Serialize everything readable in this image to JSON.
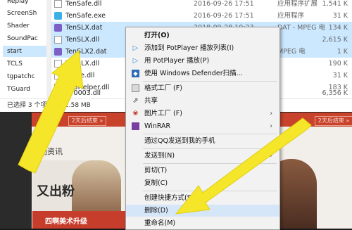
{
  "nav": {
    "items": [
      {
        "label": "Replay"
      },
      {
        "label": "ScreenSh"
      },
      {
        "label": "Shader"
      },
      {
        "label": "SoundPac"
      },
      {
        "label": "start"
      },
      {
        "label": "TCLS"
      },
      {
        "label": "tgpatchc"
      },
      {
        "label": "TGuard"
      }
    ]
  },
  "files": [
    {
      "name": "TenSafe.dll",
      "date": "2016-09-26 17:51",
      "type": "应用程序扩展",
      "size": "1,541 K",
      "icon": "dll-icon",
      "selected": false
    },
    {
      "name": "TenSafe.exe",
      "date": "2016-09-26 17:51",
      "type": "应用程序",
      "size": "31 K",
      "icon": "exe-icon",
      "selected": false
    },
    {
      "name": "TenSLX.dat",
      "date": "2018-09-28 10:23",
      "type": "DAT - MPEG 电",
      "size": "134 K",
      "icon": "dat-icon",
      "selected": true
    },
    {
      "name": "TenSLX.dll",
      "date": "",
      "type": "",
      "size": "2,615 K",
      "icon": "dll-icon",
      "selected": true
    },
    {
      "name": "TenSLX2.dat",
      "date": "",
      "type": "MPEG 电",
      "size": "1 K",
      "icon": "dat-icon",
      "selected": true
    },
    {
      "name": "TenSLX.dll",
      "date": "",
      "type": "",
      "size": "190 K",
      "icon": "dll-icon",
      "selected": false
    },
    {
      "name": "Tence.dll",
      "date": "",
      "type": "",
      "size": "31 K",
      "icon": "dll-icon",
      "selected": false
    },
    {
      "name": "TP3Helper.dll",
      "date": "",
      "type": "",
      "size": "183 K",
      "icon": "dll-icon",
      "selected": false
    },
    {
      "name": "TP0003.dll",
      "date": "",
      "type": "",
      "size": "6,356 K",
      "icon": "dll-icon",
      "selected": false
    }
  ],
  "status": {
    "selected": "已选择 3 个项目",
    "size": "2.58 MB"
  },
  "background": {
    "tag_left": "2天后结束 »",
    "tag_right": "2天后结束 »",
    "section_title": "热门资讯",
    "promo_title": "又出粉",
    "promo_bar": "四啊美术升级"
  },
  "menu": {
    "items": [
      {
        "label": "打开(O)",
        "icon": "none",
        "bold": true
      },
      {
        "label": "添加到 PotPlayer 播放列表(I)",
        "icon": "play-icon"
      },
      {
        "label": "用 PotPlayer 播放(P)",
        "icon": "play-icon"
      },
      {
        "label": "使用 Windows Defender扫描...",
        "icon": "shield-icon"
      },
      {
        "label": "格式工厂 (F)",
        "icon": "format-factory-icon"
      },
      {
        "label": "共享",
        "icon": "share-icon"
      },
      {
        "label": "图片工厂 (F)",
        "icon": "picture-factory-icon",
        "submenu": true
      },
      {
        "label": "WinRAR",
        "icon": "winrar-icon",
        "submenu": true
      },
      {
        "label": "通过QQ发送到我的手机",
        "icon": "none"
      },
      {
        "label": "发送到(N)",
        "icon": "none",
        "submenu": true
      },
      {
        "label": "剪切(T)",
        "icon": "none"
      },
      {
        "label": "复制(C)",
        "icon": "none"
      },
      {
        "label": "创建快捷方式(S)",
        "icon": "none"
      },
      {
        "label": "删除(D)",
        "icon": "none",
        "highlighted": true
      },
      {
        "label": "重命名(M)",
        "icon": "none"
      }
    ]
  },
  "colors": {
    "selection": "#cce8ff",
    "arrow": "#f5e62a",
    "menu_bg": "#f2f2f2",
    "banner_red": "#c9432c"
  }
}
